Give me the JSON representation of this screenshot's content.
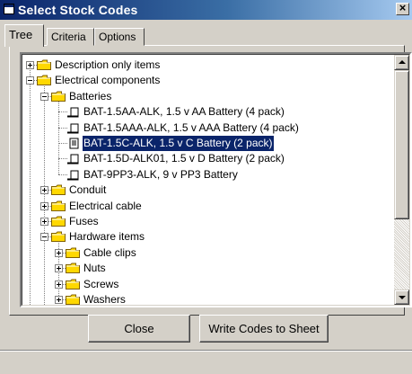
{
  "window": {
    "title": "Select Stock Codes",
    "close_label": "×"
  },
  "tabs": [
    {
      "label": "Tree",
      "active": true
    },
    {
      "label": "Criteria",
      "active": false
    },
    {
      "label": "Options",
      "active": false
    }
  ],
  "tree": {
    "items": [
      {
        "label": "Description only items",
        "level": 0,
        "type": "folder",
        "expander": "plus"
      },
      {
        "label": "Electrical components",
        "level": 0,
        "type": "folder",
        "expander": "minus"
      },
      {
        "label": "Batteries",
        "level": 1,
        "type": "folder",
        "expander": "minus"
      },
      {
        "label": "BAT-1.5AA-ALK, 1.5 v AA Battery (4 pack)",
        "level": 2,
        "type": "item"
      },
      {
        "label": "BAT-1.5AAA-ALK, 1.5 v AAA Battery (4 pack)",
        "level": 2,
        "type": "item"
      },
      {
        "label": "BAT-1.5C-ALK, 1.5 v C Battery (2 pack)",
        "level": 2,
        "type": "item",
        "selected": true
      },
      {
        "label": "BAT-1.5D-ALK01, 1.5 v D Battery (2 pack)",
        "level": 2,
        "type": "item"
      },
      {
        "label": "BAT-9PP3-ALK, 9 v PP3 Battery",
        "level": 2,
        "type": "item"
      },
      {
        "label": "Conduit",
        "level": 1,
        "type": "folder",
        "expander": "plus"
      },
      {
        "label": "Electrical cable",
        "level": 1,
        "type": "folder",
        "expander": "plus"
      },
      {
        "label": "Fuses",
        "level": 1,
        "type": "folder",
        "expander": "plus"
      },
      {
        "label": "Hardware items",
        "level": 1,
        "type": "folder",
        "expander": "minus"
      },
      {
        "label": "Cable clips",
        "level": 2,
        "type": "folder",
        "expander": "plus"
      },
      {
        "label": "Nuts",
        "level": 2,
        "type": "folder",
        "expander": "plus"
      },
      {
        "label": "Screws",
        "level": 2,
        "type": "folder",
        "expander": "plus"
      },
      {
        "label": "Washers",
        "level": 2,
        "type": "folder",
        "expander": "plus"
      }
    ]
  },
  "buttons": {
    "close": "Close",
    "write": "Write Codes to Sheet"
  },
  "colors": {
    "titlebar": "#0a246a",
    "selection": "#0a246a",
    "folder": "#ffd800",
    "face": "#d4d0c8"
  }
}
